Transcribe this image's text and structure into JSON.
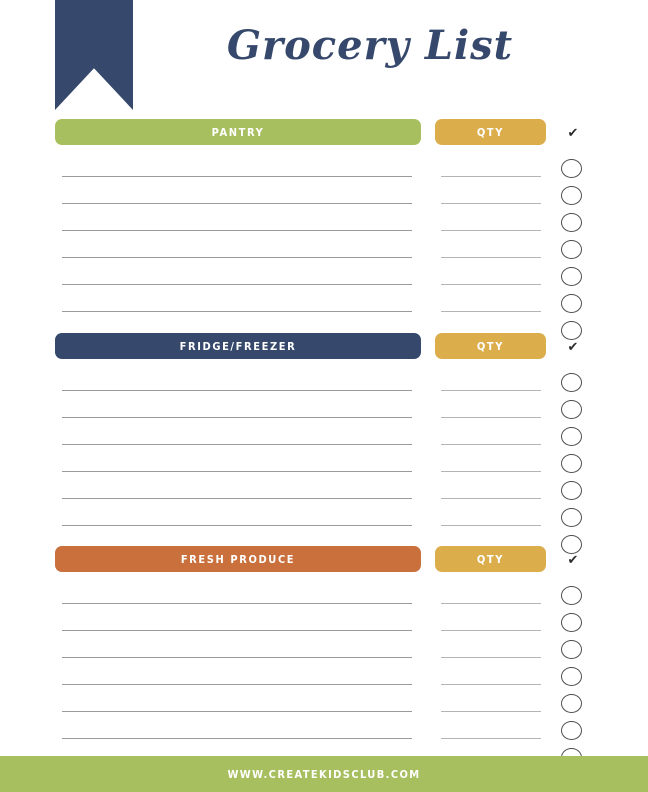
{
  "document": {
    "title": "Grocery List",
    "ribbon_color": "#36486b"
  },
  "columns": {
    "qty_label": "QTY",
    "check_icon": "✔"
  },
  "sections": [
    {
      "label": "PANTRY",
      "color": "#a8bf60",
      "qty_label": "QTY",
      "qty_color": "#dcad4b",
      "check_icon": "✔",
      "row_count": 7
    },
    {
      "label": "FRIDGE/FREEZER",
      "color": "#36486b",
      "qty_label": "QTY",
      "qty_color": "#dcad4b",
      "check_icon": "✔",
      "row_count": 7
    },
    {
      "label": "FRESH PRODUCE",
      "color": "#c9703c",
      "qty_label": "QTY",
      "qty_color": "#dcad4b",
      "check_icon": "✔",
      "row_count": 7
    }
  ],
  "footer": {
    "text": "WWW.CREATEKIDSCLUB.COM",
    "background": "#a8bf60"
  }
}
